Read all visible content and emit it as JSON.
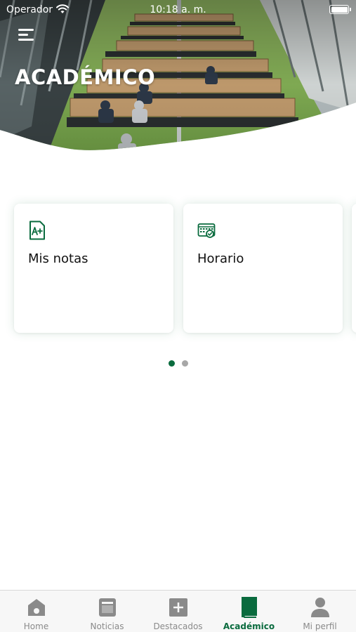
{
  "status_bar": {
    "carrier": "Operador",
    "time": "10:18 a. m."
  },
  "header": {
    "title": "ACADÉMICO",
    "menu_icon": "hamburger-menu-icon",
    "background_image": "library-study-room-photo"
  },
  "cards": [
    {
      "label": "Mis notas",
      "icon": "grade-document-icon"
    },
    {
      "label": "Horario",
      "icon": "calendar-schedule-icon"
    }
  ],
  "pager": {
    "pages": 2,
    "active_index": 0
  },
  "tabbar": {
    "items": [
      {
        "label": "Home",
        "icon": "home-icon",
        "active": false
      },
      {
        "label": "Noticias",
        "icon": "news-icon",
        "active": false
      },
      {
        "label": "Destacados",
        "icon": "plus-box-icon",
        "active": false
      },
      {
        "label": "Académico",
        "icon": "book-icon",
        "active": true
      },
      {
        "label": "Mi perfil",
        "icon": "user-icon",
        "active": false
      }
    ]
  },
  "colors": {
    "accent": "#0a6b3e",
    "inactive": "#8a8a8a",
    "tabbar_bg": "#f7f7f7"
  }
}
